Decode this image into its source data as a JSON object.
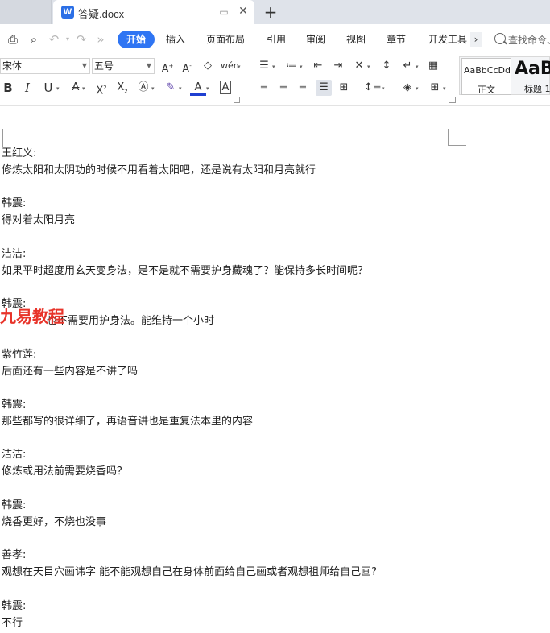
{
  "tabs": {
    "doc_title": "答疑.docx",
    "doc_icon_letter": "W"
  },
  "menu": {
    "items": [
      "开始",
      "插入",
      "页面布局",
      "引用",
      "审阅",
      "视图",
      "章节",
      "开发工具"
    ],
    "search_text": "查找命令、"
  },
  "ribbon": {
    "font_name": "宋体",
    "font_size": "五号",
    "styles": {
      "normal_sample": "AaBbCcDd",
      "normal_label": "正文",
      "heading_sample": "AaB",
      "heading_label": "标题 1"
    }
  },
  "document": {
    "lines": [
      "王红义:",
      "修炼太阳和太阴功的时候不用看着太阳吧，还是说有太阳和月亮就行",
      "韩震:",
      "得对着太阳月亮",
      "洁洁:",
      "如果平时超度用玄天变身法，是不是就不需要护身藏魂了？能保持多长时间呢？",
      "韩震:",
      "也不需要用护身法。能维持一个小时",
      "紫竹莲:",
      "后面还有一些内容是不讲了吗",
      "韩震:",
      "那些都写的很详细了，再语音讲也是重复法本里的内容",
      "洁洁:",
      "修炼或用法前需要烧香吗？",
      "韩震:",
      "烧香更好，不烧也没事",
      "善孝:",
      "观想在天目穴画讳字 能不能观想自己在身体前面给自己画或者观想祖师给自己画?",
      "韩震:",
      "不行"
    ],
    "watermark": "九易教程"
  }
}
